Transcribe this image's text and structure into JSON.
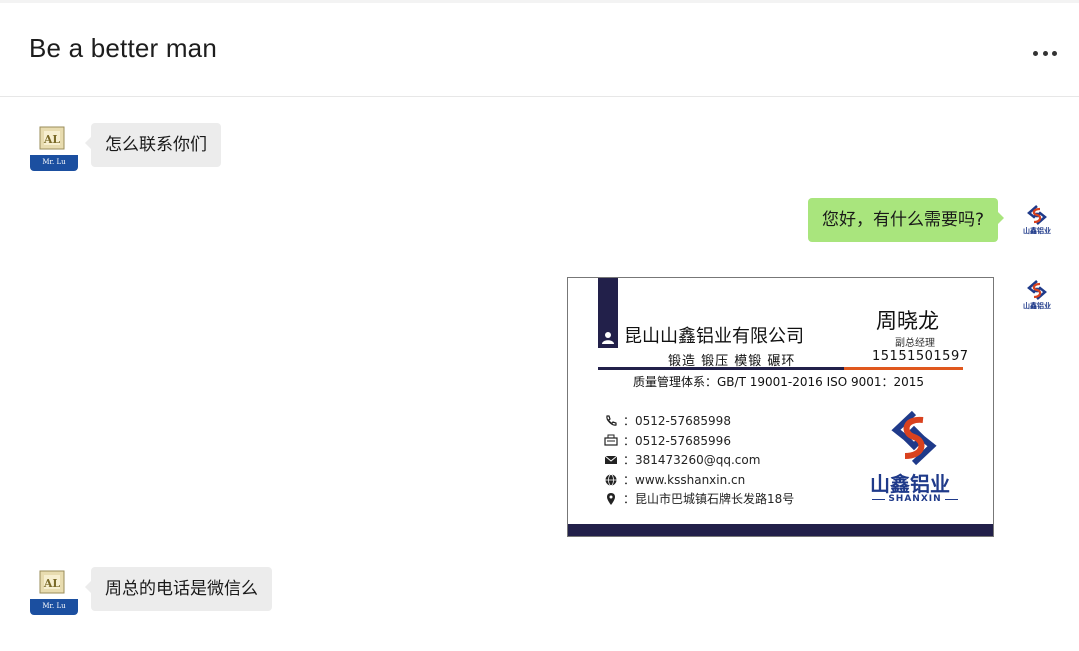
{
  "header": {
    "title": "Be a better man"
  },
  "messages": [
    {
      "side": "in",
      "text": "怎么联系你们"
    },
    {
      "side": "out",
      "text": "您好，有什么需要吗?"
    },
    {
      "side": "in",
      "text": "周总的电话是微信么"
    }
  ],
  "avatars": {
    "user_label": "Mr. Lu",
    "user_letters": "AL"
  },
  "card": {
    "company": "昆山山鑫铝业有限公司",
    "services": "锻造  锻压  模锻  碾环",
    "person_name": "周晓龙",
    "person_title": "副总经理",
    "person_phone": "15151501597",
    "certification": "质量管理体系：GB/T 19001-2016   ISO 9001：2015",
    "contacts": [
      {
        "icon": "phone-icon",
        "text": "：0512-57685998"
      },
      {
        "icon": "fax-icon",
        "text": "：0512-57685996"
      },
      {
        "icon": "mail-icon",
        "text": "：381473260@qq.com"
      },
      {
        "icon": "globe-icon",
        "text": "：www.ksshanxin.cn"
      },
      {
        "icon": "location-icon",
        "text": "：昆山市巴城镇石牌长发路18号"
      }
    ],
    "logo_cn": "山鑫铝业",
    "logo_en": "SHANXIN",
    "colors": {
      "navy": "#22204a",
      "red": "#d9421f",
      "orange": "#e0581e",
      "blue": "#1f3a8a"
    }
  }
}
